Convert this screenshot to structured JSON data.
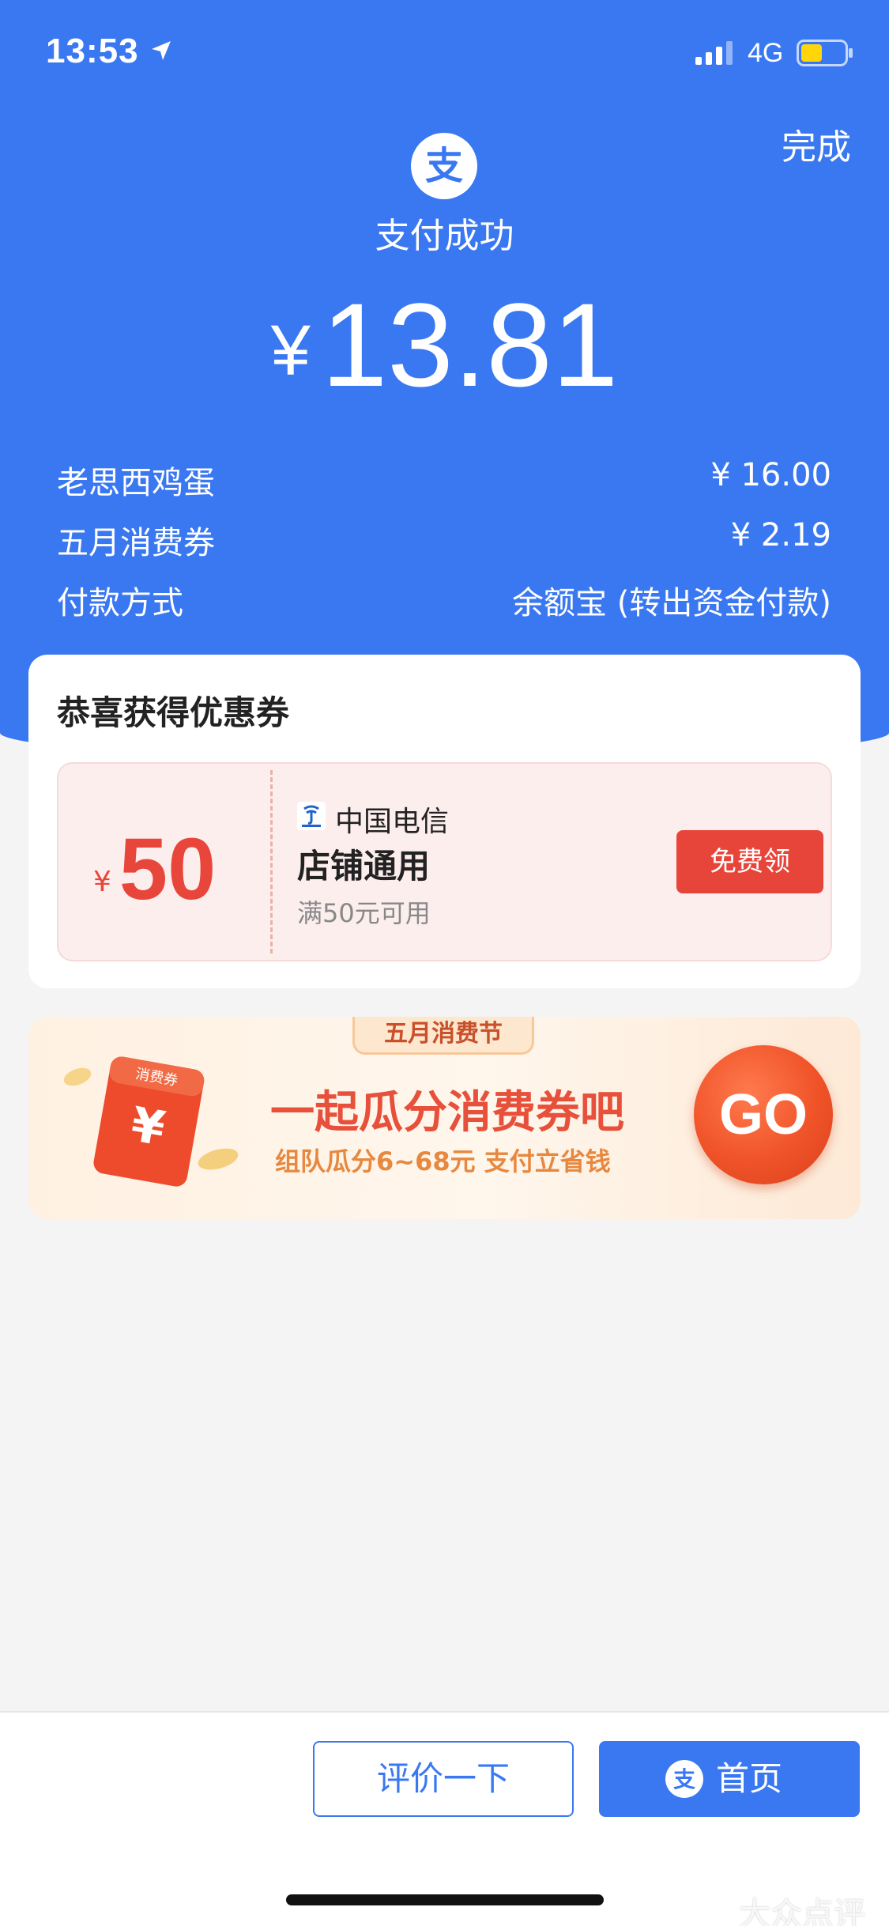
{
  "status_bar": {
    "time": "13:53",
    "network": "4G"
  },
  "header": {
    "done_label": "完成",
    "status_text": "支付成功",
    "currency": "¥",
    "amount": "13.81"
  },
  "details": [
    {
      "label": "老思西鸡蛋",
      "value": "¥ 16.00"
    },
    {
      "label": "五月消费券",
      "value": "¥ 2.19"
    },
    {
      "label": "付款方式",
      "value": "余额宝 (转出资金付款)"
    }
  ],
  "coupon_section": {
    "title": "恭喜获得优惠券",
    "coupon": {
      "currency": "¥",
      "amount": "50",
      "merchant": "中国电信",
      "scope": "店铺通用",
      "condition": "满50元可用",
      "claim_label": "免费领"
    }
  },
  "banner": {
    "tag": "五月消费节",
    "envelope_label": "消费券",
    "headline": "一起瓜分消费券吧",
    "subline": "组队瓜分6~68元  支付立省钱",
    "go_label": "GO"
  },
  "bottom": {
    "review_label": "评价一下",
    "home_label": "首页"
  },
  "watermark": "大众点评",
  "colors": {
    "brand_blue": "#3a78f2",
    "coupon_red": "#e8453a"
  }
}
